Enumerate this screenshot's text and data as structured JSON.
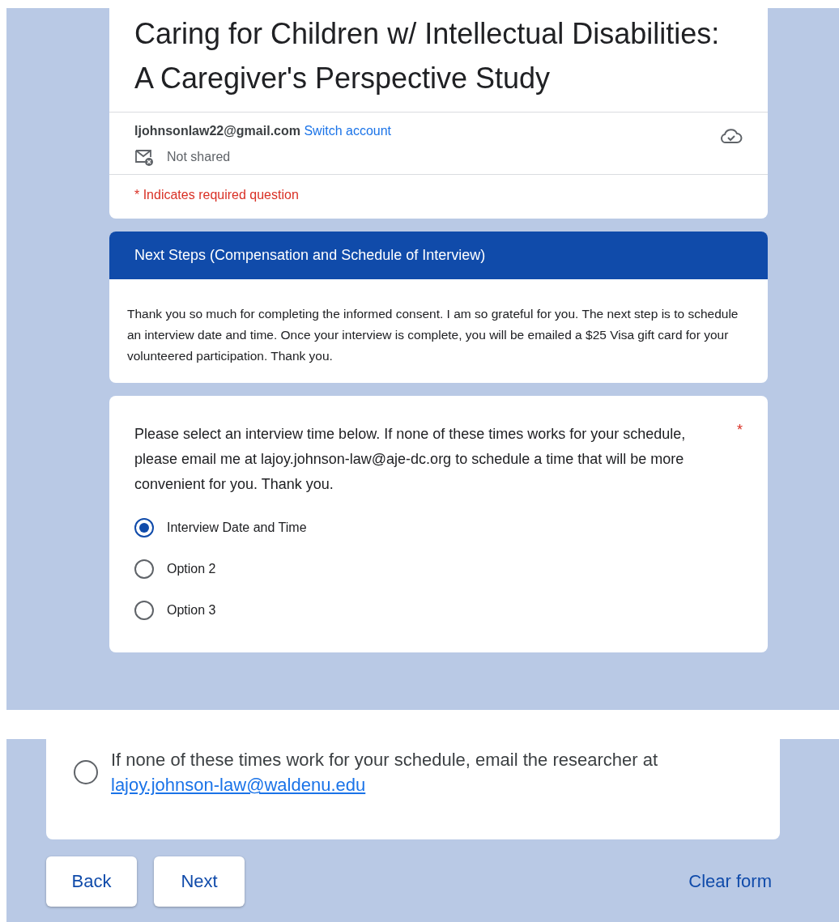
{
  "form_header": {
    "title": "Caring for Children w/ Intellectual Disabilities: A Caregiver's Perspective Study",
    "account_email": "ljohnsonlaw22@gmail.com",
    "switch_account": "Switch account",
    "sharing": "Not shared",
    "required_note": "* Indicates required question"
  },
  "section": {
    "title": "Next Steps (Compensation and Schedule of Interview)",
    "description": "Thank you so much for completing the informed consent. I am so grateful for you. The next step is to schedule an interview date and time. Once your interview is complete, you will be emailed a $25 Visa gift card for your volunteered participation. Thank you."
  },
  "question": {
    "text": "Please select an interview time below. If none of these times works for your schedule, please email me at lajoy.johnson-law@aje-dc.org to schedule a time that will be more convenient for you. Thank you.",
    "required_mark": "*",
    "options": [
      {
        "label": "Interview Date and Time",
        "selected": true
      },
      {
        "label": "Option 2",
        "selected": false
      },
      {
        "label": "Option 3",
        "selected": false
      }
    ]
  },
  "continued_question": {
    "options": [
      {
        "label": "If none of these times work for your schedule, email the researcher at",
        "link": "lajoy.johnson-law@waldenu.edu",
        "selected": false
      }
    ]
  },
  "buttons": [
    {
      "label": "Back"
    },
    {
      "label": "Next"
    }
  ],
  "clear_form": "Clear form"
}
